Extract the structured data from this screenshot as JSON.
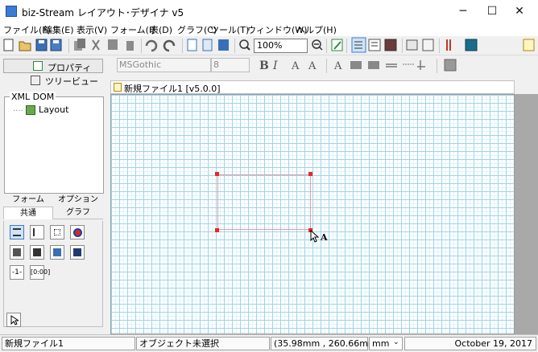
{
  "window": {
    "title": "biz-Stream レイアウト･デザイナ v5",
    "minimize": "─",
    "maximize": "☐",
    "close": "✕"
  },
  "menu": [
    "ファイル(F)",
    "編集(E)",
    "表示(V)",
    "フォーム(I)",
    "表(D)",
    "グラフ(C)",
    "ツール(T)",
    "ウィンドウ(W)",
    "ヘルプ(H)"
  ],
  "toolbar": {
    "zoom_value": "100%",
    "font_name": "MSGothic",
    "font_size": "8",
    "bold": "B",
    "italic": "I"
  },
  "left_panel": {
    "properties_label": "プロパティ",
    "treeview_label": "ツリービュー",
    "xml_dom_label": "XML DOM",
    "tree_node": "Layout",
    "tabs_row1": [
      "フォーム",
      "オプション"
    ],
    "tabs_row2": [
      "共通",
      "グラフ"
    ],
    "active_tab": "共通",
    "palette_text1": "-1-",
    "palette_text2": "[0:00]"
  },
  "document": {
    "tab_title": "新規ファイル1 [v5.0.0]",
    "cursor_label": "A"
  },
  "status": {
    "file": "新規ファイル1",
    "selection": "オブジェクト未選択",
    "coords": "(35.98mm , 260.66mm)",
    "unit": "mm",
    "date": "October 19, 2017"
  },
  "colors": {
    "accent": "#3a7bd5",
    "grid": "#9ed4ea",
    "handle": "#e8272c"
  }
}
